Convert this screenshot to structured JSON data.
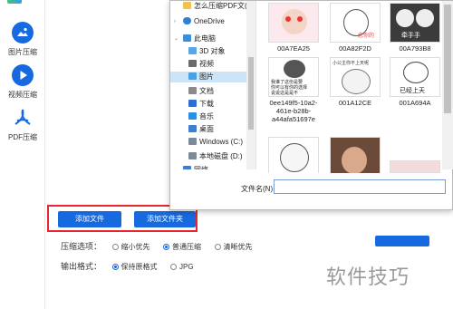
{
  "sidebar": {
    "items": [
      {
        "label": "图片压缩"
      },
      {
        "label": "视频压缩"
      },
      {
        "label": "PDF压缩"
      }
    ]
  },
  "main": {
    "add_file_button": "添加文件",
    "add_folder_button": "添加文件夹",
    "compress_options": {
      "label": "压缩选项：",
      "choices": [
        "缩小优先",
        "普通压缩",
        "清晰优先"
      ],
      "selected": "普通压缩"
    },
    "output_format": {
      "label": "输出格式：",
      "choices": [
        "保持原格式",
        "JPG"
      ],
      "selected": "保持原格式"
    }
  },
  "watermark": "软件技巧",
  "dialog": {
    "nav_top_item": "怎么压缩PDF文(",
    "nav": [
      {
        "label": "OneDrive",
        "icon": "cloud-icon"
      },
      {
        "label": "此电脑",
        "icon": "computer-icon"
      },
      {
        "label": "3D 对象",
        "icon": "cube-icon"
      },
      {
        "label": "视频",
        "icon": "video-icon"
      },
      {
        "label": "图片",
        "icon": "picture-icon"
      },
      {
        "label": "文档",
        "icon": "document-icon"
      },
      {
        "label": "下载",
        "icon": "download-icon"
      },
      {
        "label": "音乐",
        "icon": "music-icon"
      },
      {
        "label": "桌面",
        "icon": "desktop-icon"
      },
      {
        "label": "Windows (C:)",
        "icon": "drive-icon"
      },
      {
        "label": "本地磁盘 (D:)",
        "icon": "drive-icon"
      },
      {
        "label": "网络",
        "icon": "network-icon"
      }
    ],
    "files": [
      {
        "name": "00A7EA25"
      },
      {
        "name": "00A82F2D"
      },
      {
        "name": "00A793B8"
      },
      {
        "name": "0ee149f5-10a2-461e-b28b-a44afa51697e"
      },
      {
        "name": "001A12CE"
      },
      {
        "name": "001A694A"
      }
    ],
    "thumb_texts": {
      "t2": "念你的",
      "t3": "牵手手",
      "t4a": "我谁了这份是要",
      "t4b": "你可以有你的选择",
      "t4c": "说说这是是不",
      "t5": "小公主你不上天呢",
      "t6": "已经上天"
    },
    "filename_label": "文件名(N):",
    "filename_value": ""
  },
  "colors": {
    "accent": "#1769e0",
    "highlight": "#e8262e",
    "selection": "#cce4f7"
  }
}
